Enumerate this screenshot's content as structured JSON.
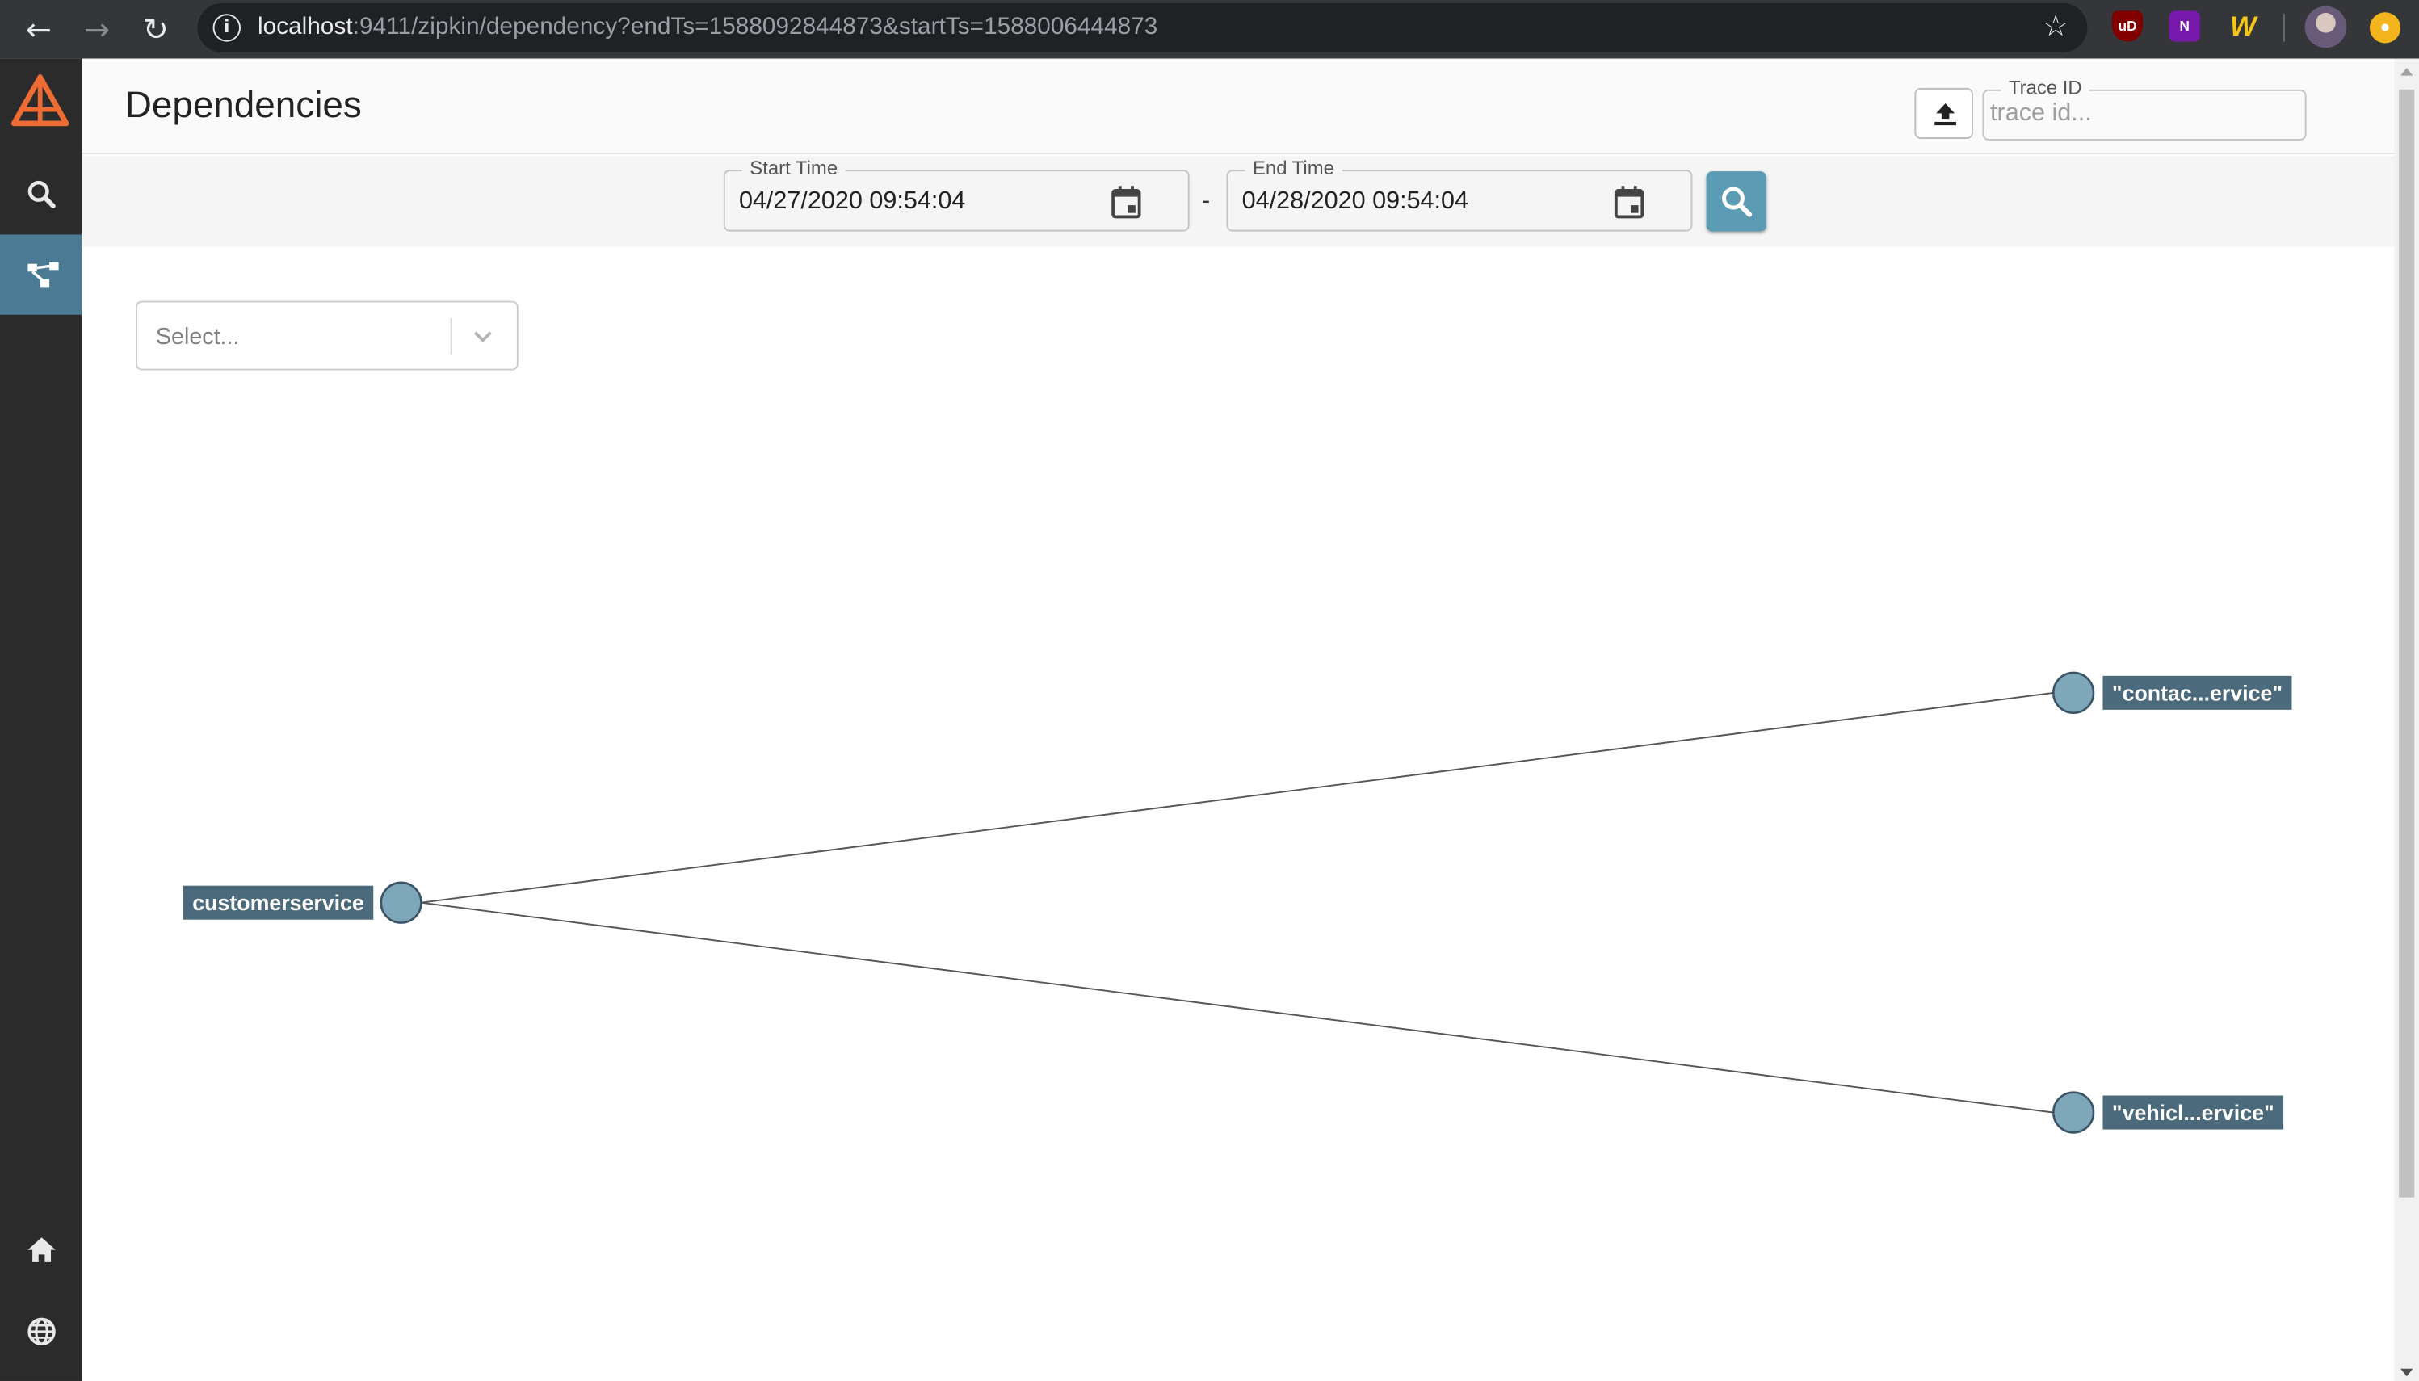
{
  "browser": {
    "url_host": "localhost",
    "url_rest": ":9411/zipkin/dependency?endTs=1588092844873&startTs=1588006444873",
    "extensions": {
      "ublock": "uD",
      "onenote": "N"
    }
  },
  "header": {
    "title": "Dependencies",
    "trace_id_label": "Trace ID",
    "trace_id_placeholder": "trace id..."
  },
  "timebar": {
    "start_label": "Start Time",
    "start_value": "04/27/2020 09:54:04",
    "separator": "-",
    "end_label": "End Time",
    "end_value": "04/28/2020 09:54:04"
  },
  "filter": {
    "placeholder": "Select..."
  },
  "graph": {
    "nodes": [
      {
        "id": "customerservice",
        "label": "customerservice"
      },
      {
        "id": "contact",
        "label": "\"contac...ervice\""
      },
      {
        "id": "vehicle",
        "label": "\"vehicl...ervice\""
      }
    ],
    "edges": [
      {
        "from": "customerservice",
        "to": "contact"
      },
      {
        "from": "customerservice",
        "to": "vehicle"
      }
    ]
  },
  "colors": {
    "accent": "#4b7a94",
    "search_button": "#5b9bb4",
    "node_fill": "#7fa7ba",
    "label_bg": "#4b6a7c",
    "logo": "#ee6b33"
  }
}
